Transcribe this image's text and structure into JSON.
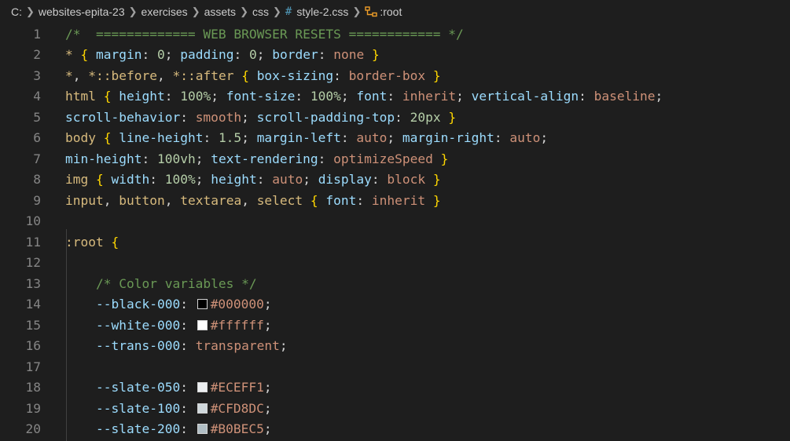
{
  "breadcrumb": {
    "items": [
      "C:",
      "websites-epita-23",
      "exercises",
      "assets",
      "css",
      "style-2.css",
      ":root"
    ]
  },
  "colors": {
    "background": "#1e1e1e",
    "comment": "#6a9955",
    "selector": "#d7ba7d",
    "property": "#9cdcfe",
    "value": "#ce9178",
    "number": "#b5cea8",
    "bracket": "#ffd700"
  },
  "lines": [
    {
      "num": "1",
      "indent": "",
      "tokens": [
        {
          "c": "c",
          "t": "/*  ============= WEB BROWSER RESETS ============ */"
        }
      ]
    },
    {
      "num": "2",
      "indent": "",
      "tokens": [
        {
          "c": "s",
          "t": "*"
        },
        {
          "c": "t",
          "t": " "
        },
        {
          "c": "b",
          "t": "{"
        },
        {
          "c": "t",
          "t": " "
        },
        {
          "c": "p",
          "t": "margin"
        },
        {
          "c": "t",
          "t": ": "
        },
        {
          "c": "n",
          "t": "0"
        },
        {
          "c": "t",
          "t": "; "
        },
        {
          "c": "p",
          "t": "padding"
        },
        {
          "c": "t",
          "t": ": "
        },
        {
          "c": "n",
          "t": "0"
        },
        {
          "c": "t",
          "t": "; "
        },
        {
          "c": "p",
          "t": "border"
        },
        {
          "c": "t",
          "t": ": "
        },
        {
          "c": "v",
          "t": "none"
        },
        {
          "c": "t",
          "t": " "
        },
        {
          "c": "b",
          "t": "}"
        }
      ]
    },
    {
      "num": "3",
      "indent": "",
      "tokens": [
        {
          "c": "s",
          "t": "*"
        },
        {
          "c": "t",
          "t": ", "
        },
        {
          "c": "s",
          "t": "*::before"
        },
        {
          "c": "t",
          "t": ", "
        },
        {
          "c": "s",
          "t": "*::after"
        },
        {
          "c": "t",
          "t": " "
        },
        {
          "c": "b",
          "t": "{"
        },
        {
          "c": "t",
          "t": " "
        },
        {
          "c": "p",
          "t": "box-sizing"
        },
        {
          "c": "t",
          "t": ": "
        },
        {
          "c": "v",
          "t": "border-box"
        },
        {
          "c": "t",
          "t": " "
        },
        {
          "c": "b",
          "t": "}"
        }
      ]
    },
    {
      "num": "4",
      "indent": "",
      "tokens": [
        {
          "c": "s",
          "t": "html"
        },
        {
          "c": "t",
          "t": " "
        },
        {
          "c": "b",
          "t": "{"
        },
        {
          "c": "t",
          "t": " "
        },
        {
          "c": "p",
          "t": "height"
        },
        {
          "c": "t",
          "t": ": "
        },
        {
          "c": "n",
          "t": "100%"
        },
        {
          "c": "t",
          "t": "; "
        },
        {
          "c": "p",
          "t": "font-size"
        },
        {
          "c": "t",
          "t": ": "
        },
        {
          "c": "n",
          "t": "100%"
        },
        {
          "c": "t",
          "t": "; "
        },
        {
          "c": "p",
          "t": "font"
        },
        {
          "c": "t",
          "t": ": "
        },
        {
          "c": "v",
          "t": "inherit"
        },
        {
          "c": "t",
          "t": "; "
        },
        {
          "c": "p",
          "t": "vertical-align"
        },
        {
          "c": "t",
          "t": ": "
        },
        {
          "c": "v",
          "t": "baseline"
        },
        {
          "c": "t",
          "t": ";"
        }
      ]
    },
    {
      "num": "5",
      "indent": "",
      "tokens": [
        {
          "c": "p",
          "t": "scroll-behavior"
        },
        {
          "c": "t",
          "t": ": "
        },
        {
          "c": "v",
          "t": "smooth"
        },
        {
          "c": "t",
          "t": "; "
        },
        {
          "c": "p",
          "t": "scroll-padding-top"
        },
        {
          "c": "t",
          "t": ": "
        },
        {
          "c": "n",
          "t": "20px"
        },
        {
          "c": "t",
          "t": " "
        },
        {
          "c": "b",
          "t": "}"
        }
      ]
    },
    {
      "num": "6",
      "indent": "",
      "tokens": [
        {
          "c": "s",
          "t": "body"
        },
        {
          "c": "t",
          "t": " "
        },
        {
          "c": "b",
          "t": "{"
        },
        {
          "c": "t",
          "t": " "
        },
        {
          "c": "p",
          "t": "line-height"
        },
        {
          "c": "t",
          "t": ": "
        },
        {
          "c": "n",
          "t": "1.5"
        },
        {
          "c": "t",
          "t": "; "
        },
        {
          "c": "p",
          "t": "margin-left"
        },
        {
          "c": "t",
          "t": ": "
        },
        {
          "c": "v",
          "t": "auto"
        },
        {
          "c": "t",
          "t": "; "
        },
        {
          "c": "p",
          "t": "margin-right"
        },
        {
          "c": "t",
          "t": ": "
        },
        {
          "c": "v",
          "t": "auto"
        },
        {
          "c": "t",
          "t": ";"
        }
      ]
    },
    {
      "num": "7",
      "indent": "",
      "tokens": [
        {
          "c": "p",
          "t": "min-height"
        },
        {
          "c": "t",
          "t": ": "
        },
        {
          "c": "n",
          "t": "100vh"
        },
        {
          "c": "t",
          "t": "; "
        },
        {
          "c": "p",
          "t": "text-rendering"
        },
        {
          "c": "t",
          "t": ": "
        },
        {
          "c": "v",
          "t": "optimizeSpeed"
        },
        {
          "c": "t",
          "t": " "
        },
        {
          "c": "b",
          "t": "}"
        }
      ]
    },
    {
      "num": "8",
      "indent": "",
      "tokens": [
        {
          "c": "s",
          "t": "img"
        },
        {
          "c": "t",
          "t": " "
        },
        {
          "c": "b",
          "t": "{"
        },
        {
          "c": "t",
          "t": " "
        },
        {
          "c": "p",
          "t": "width"
        },
        {
          "c": "t",
          "t": ": "
        },
        {
          "c": "n",
          "t": "100%"
        },
        {
          "c": "t",
          "t": "; "
        },
        {
          "c": "p",
          "t": "height"
        },
        {
          "c": "t",
          "t": ": "
        },
        {
          "c": "v",
          "t": "auto"
        },
        {
          "c": "t",
          "t": "; "
        },
        {
          "c": "p",
          "t": "display"
        },
        {
          "c": "t",
          "t": ": "
        },
        {
          "c": "v",
          "t": "block"
        },
        {
          "c": "t",
          "t": " "
        },
        {
          "c": "b",
          "t": "}"
        }
      ]
    },
    {
      "num": "9",
      "indent": "",
      "tokens": [
        {
          "c": "s",
          "t": "input"
        },
        {
          "c": "t",
          "t": ", "
        },
        {
          "c": "s",
          "t": "button"
        },
        {
          "c": "t",
          "t": ", "
        },
        {
          "c": "s",
          "t": "textarea"
        },
        {
          "c": "t",
          "t": ", "
        },
        {
          "c": "s",
          "t": "select"
        },
        {
          "c": "t",
          "t": " "
        },
        {
          "c": "b",
          "t": "{"
        },
        {
          "c": "t",
          "t": " "
        },
        {
          "c": "p",
          "t": "font"
        },
        {
          "c": "t",
          "t": ": "
        },
        {
          "c": "v",
          "t": "inherit"
        },
        {
          "c": "t",
          "t": " "
        },
        {
          "c": "b",
          "t": "}"
        }
      ]
    },
    {
      "num": "10",
      "indent": "",
      "tokens": []
    },
    {
      "num": "11",
      "indent": "",
      "tokens": [
        {
          "c": "s",
          "t": ":root"
        },
        {
          "c": "t",
          "t": " "
        },
        {
          "c": "b",
          "t": "{"
        }
      ]
    },
    {
      "num": "12",
      "indent": "",
      "tokens": []
    },
    {
      "num": "13",
      "indent": "    ",
      "tokens": [
        {
          "c": "c",
          "t": "/* Color variables */"
        }
      ]
    },
    {
      "num": "14",
      "indent": "    ",
      "tokens": [
        {
          "c": "p",
          "t": "--black-000"
        },
        {
          "c": "t",
          "t": ": "
        },
        {
          "swatch": "#000000"
        },
        {
          "c": "v",
          "t": "#000000"
        },
        {
          "c": "t",
          "t": ";"
        }
      ]
    },
    {
      "num": "15",
      "indent": "    ",
      "tokens": [
        {
          "c": "p",
          "t": "--white-000"
        },
        {
          "c": "t",
          "t": ": "
        },
        {
          "swatch": "#ffffff"
        },
        {
          "c": "v",
          "t": "#ffffff"
        },
        {
          "c": "t",
          "t": ";"
        }
      ]
    },
    {
      "num": "16",
      "indent": "    ",
      "tokens": [
        {
          "c": "p",
          "t": "--trans-000"
        },
        {
          "c": "t",
          "t": ": "
        },
        {
          "c": "v",
          "t": "transparent"
        },
        {
          "c": "t",
          "t": ";"
        }
      ]
    },
    {
      "num": "17",
      "indent": "",
      "tokens": []
    },
    {
      "num": "18",
      "indent": "    ",
      "tokens": [
        {
          "c": "p",
          "t": "--slate-050"
        },
        {
          "c": "t",
          "t": ": "
        },
        {
          "swatch": "#ECEFF1"
        },
        {
          "c": "v",
          "t": "#ECEFF1"
        },
        {
          "c": "t",
          "t": ";"
        }
      ]
    },
    {
      "num": "19",
      "indent": "    ",
      "tokens": [
        {
          "c": "p",
          "t": "--slate-100"
        },
        {
          "c": "t",
          "t": ": "
        },
        {
          "swatch": "#CFD8DC"
        },
        {
          "c": "v",
          "t": "#CFD8DC"
        },
        {
          "c": "t",
          "t": ";"
        }
      ]
    },
    {
      "num": "20",
      "indent": "    ",
      "tokens": [
        {
          "c": "p",
          "t": "--slate-200"
        },
        {
          "c": "t",
          "t": ": "
        },
        {
          "swatch": "#B0BEC5"
        },
        {
          "c": "v",
          "t": "#B0BEC5"
        },
        {
          "c": "t",
          "t": ";"
        }
      ]
    }
  ]
}
